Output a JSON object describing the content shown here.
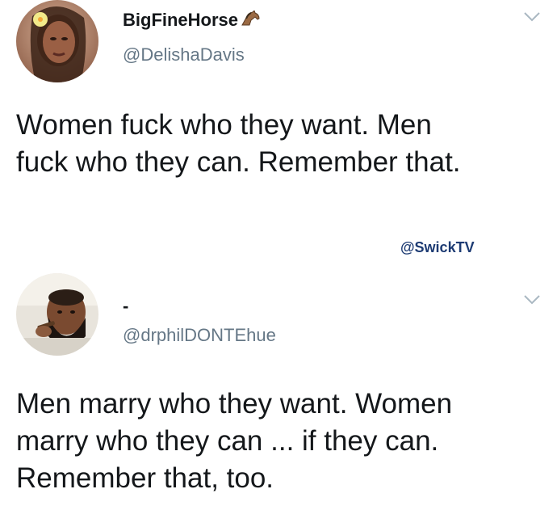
{
  "tweets": [
    {
      "display_name": "BigFineHorse",
      "name_emoji": "horse-emoji",
      "handle": "@DelishaDavis",
      "text": "Women fuck who they want. Men\nfuck who they can. Remember that.",
      "avatar": "avatar-woman-with-flower"
    },
    {
      "display_name": "-",
      "handle": "@drphilDONTEhue",
      "text": "Men marry who they want. Women\nmarry who they can ... if they can.\nRemember that, too.",
      "avatar": "avatar-man-with-cigar"
    }
  ],
  "watermark": "@SwickTV",
  "icons": {
    "menu": "chevron-down-icon"
  },
  "colors": {
    "text": "#14171a",
    "secondary": "#657786",
    "watermark": "#1d3b73"
  }
}
